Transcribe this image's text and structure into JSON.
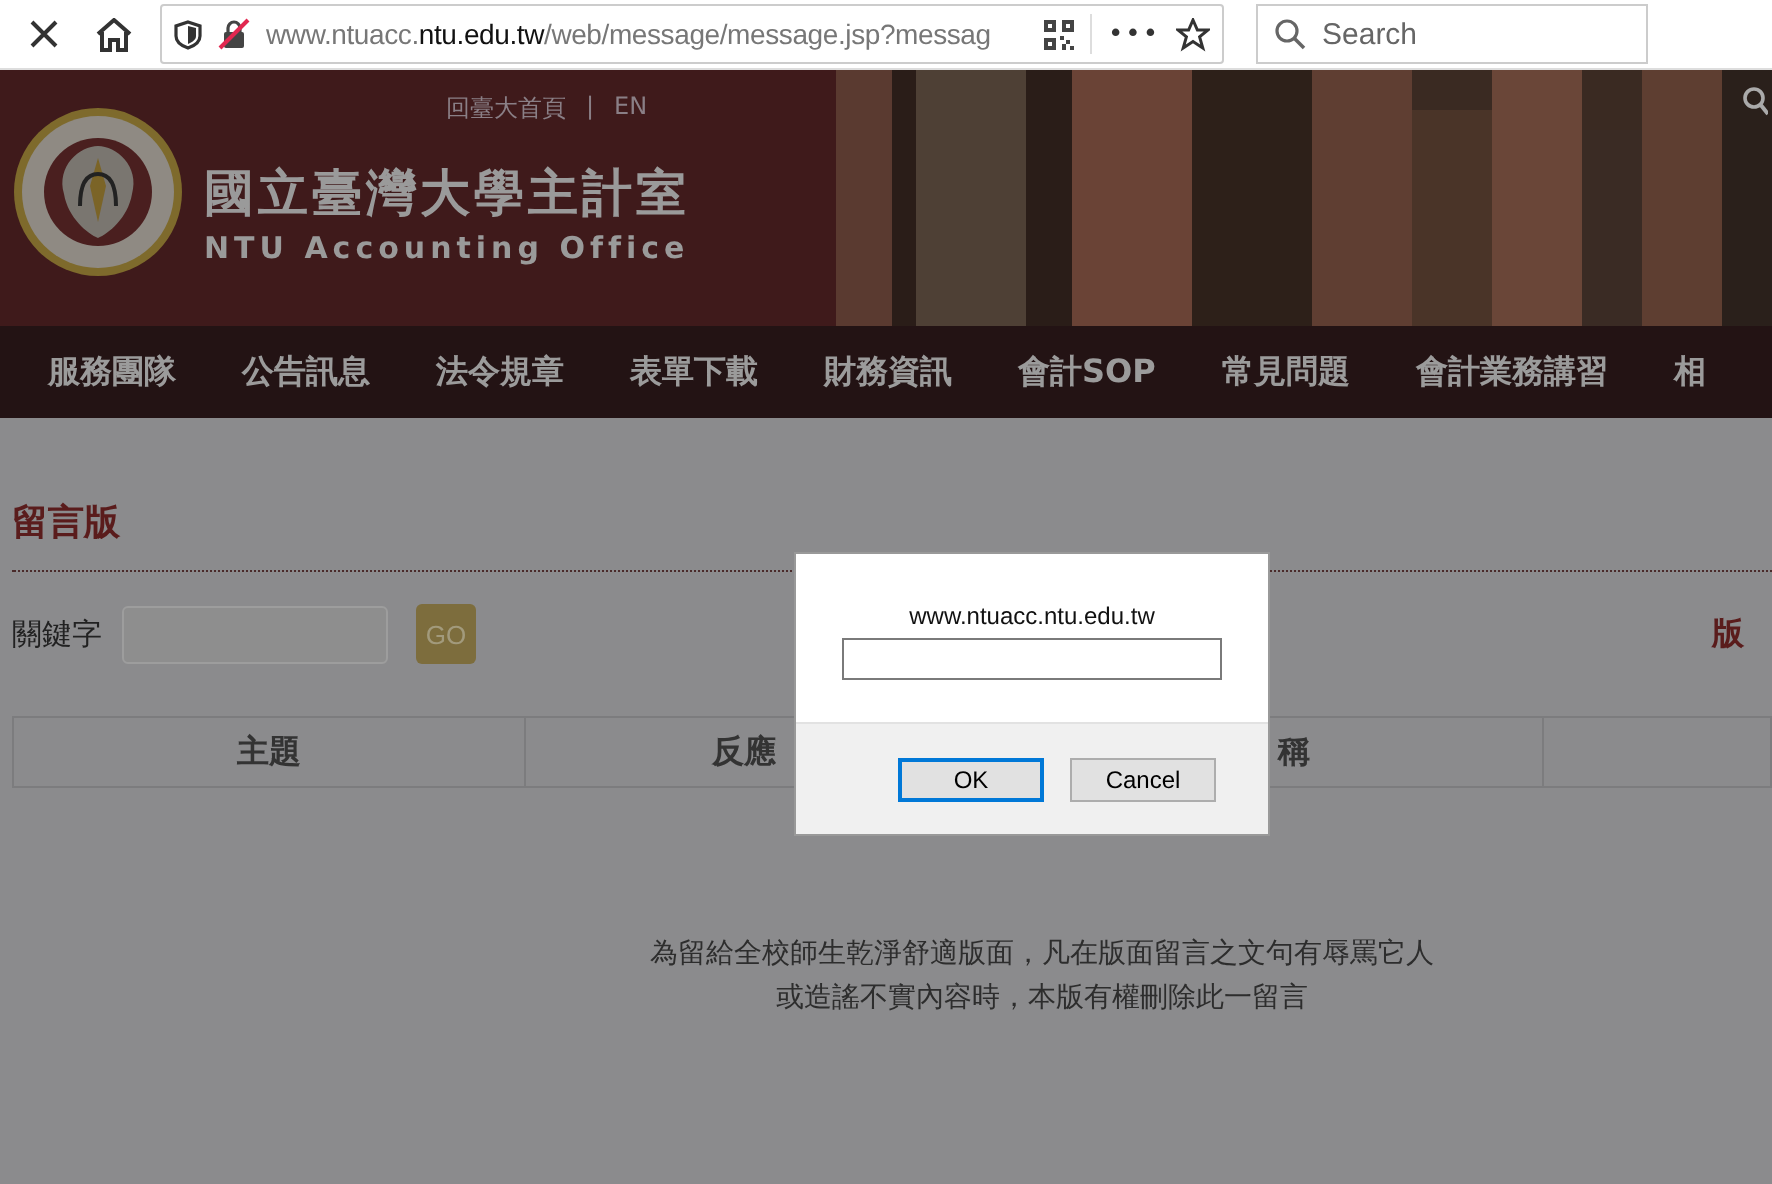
{
  "browser": {
    "url_subdomain": "www.ntuacc.",
    "url_domain": "ntu.edu.tw",
    "url_path": "/web/message/message.jsp?messag",
    "menu": "•••",
    "search": {
      "placeholder": "Search"
    }
  },
  "header": {
    "links": [
      "回臺大首頁",
      "EN"
    ],
    "separator": "|",
    "title": "國立臺灣大學主計室",
    "subtitle": "NTU Accounting Office"
  },
  "nav": [
    "服務團隊",
    "公告訊息",
    "法令規章",
    "表單下載",
    "財務資訊",
    "會計SOP",
    "常見問題",
    "會計業務講習",
    "相"
  ],
  "page": {
    "title": "留言版",
    "keyword_label": "關鍵字",
    "go_button": "GO",
    "right_link": "版",
    "columns": [
      "主題",
      "反應",
      "稱"
    ],
    "notice": [
      "為留給全校師生乾淨舒適版面，凡在版面留言之文句有辱罵它人",
      "或造謠不實內容時，本版有權刪除此一留言"
    ]
  },
  "dialog": {
    "title": "www.ntuacc.ntu.edu.tw",
    "buttons": [
      {
        "label": "OK",
        "selected": true
      },
      {
        "label": "Cancel",
        "selected": false
      }
    ]
  }
}
